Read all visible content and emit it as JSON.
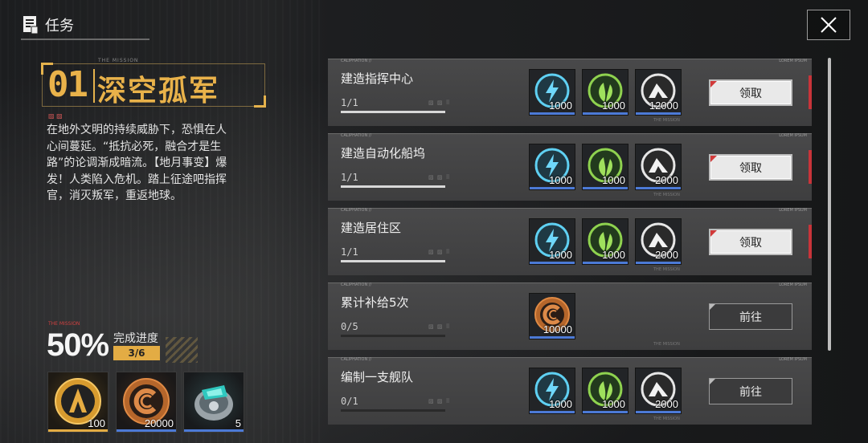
{
  "header": {
    "title": "任务"
  },
  "mission": {
    "number": "01",
    "name": "深空孤军",
    "tag": "THE MISSION",
    "description": "在地外文明的持续威胁下，恐惧在人心间蔓延。“抵抗必死，融合才是生路”的论调渐成暗流。【地月事变】爆发！人类陷入危机。踏上征途吧指挥官，消灭叛军，重返地球。"
  },
  "progress": {
    "tag": "THE MISSION",
    "percent": "50%",
    "label": "完成进度",
    "count": "3/6"
  },
  "rewards": [
    {
      "icon": "gold-a-emblem-icon",
      "qty": "100",
      "color": "#e3ac44"
    },
    {
      "icon": "bronze-credit-coin-icon",
      "qty": "20000",
      "color": "#4c7ad6"
    },
    {
      "icon": "cyan-device-icon",
      "qty": "5",
      "color": "#4c7ad6"
    }
  ],
  "task_tags": {
    "left": "CALIPHATION //",
    "right": "LOREM IPSUM",
    "foot": "THE MISSION"
  },
  "tasks": [
    {
      "name": "建造指挥中心",
      "progress": "1/1",
      "fraction": 1.0,
      "rewards": [
        {
          "icon": "energy-bolt-icon",
          "qty": "1000"
        },
        {
          "icon": "leaf-icon",
          "qty": "1000"
        },
        {
          "icon": "alloy-icon",
          "qty": "12000"
        }
      ],
      "button": "领取",
      "button_type": "claim"
    },
    {
      "name": "建造自动化船坞",
      "progress": "1/1",
      "fraction": 1.0,
      "rewards": [
        {
          "icon": "energy-bolt-icon",
          "qty": "1000"
        },
        {
          "icon": "leaf-icon",
          "qty": "1000"
        },
        {
          "icon": "alloy-icon",
          "qty": "2000"
        }
      ],
      "button": "领取",
      "button_type": "claim"
    },
    {
      "name": "建造居住区",
      "progress": "1/1",
      "fraction": 1.0,
      "rewards": [
        {
          "icon": "energy-bolt-icon",
          "qty": "1000"
        },
        {
          "icon": "leaf-icon",
          "qty": "1000"
        },
        {
          "icon": "alloy-icon",
          "qty": "2000"
        }
      ],
      "button": "领取",
      "button_type": "claim"
    },
    {
      "name": "累计补给5次",
      "progress": "0/5",
      "fraction": 0.0,
      "rewards": [
        {
          "icon": "bronze-credit-coin-icon",
          "qty": "10000"
        }
      ],
      "button": "前往",
      "button_type": "go"
    },
    {
      "name": "编制一支舰队",
      "progress": "0/1",
      "fraction": 0.0,
      "rewards": [
        {
          "icon": "energy-bolt-icon",
          "qty": "1000"
        },
        {
          "icon": "leaf-icon",
          "qty": "1000"
        },
        {
          "icon": "alloy-icon",
          "qty": "2000"
        }
      ],
      "button": "前往",
      "button_type": "go"
    }
  ],
  "colors": {
    "accent_gold": "#e9b24a",
    "claim_red": "#c8343a",
    "slot_blue": "#4c7ad6"
  }
}
